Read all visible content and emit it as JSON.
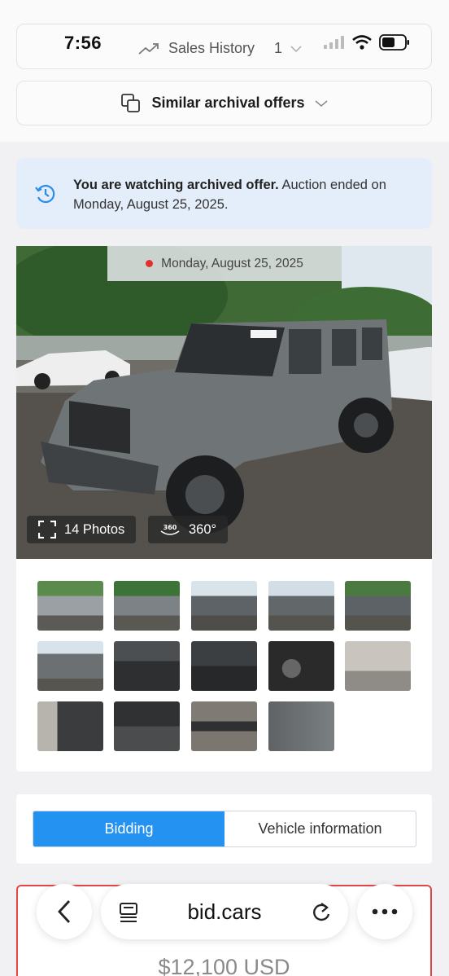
{
  "status_bar": {
    "time": "7:56",
    "sales_history_label": "Sales History",
    "sales_history_count": "1"
  },
  "similar": {
    "label": "Similar archival offers"
  },
  "notice": {
    "bold_text": "You are watching archived offer.",
    "text": " Auction ended on Monday, August 25, 2025."
  },
  "gallery": {
    "date": "Monday, August 25, 2025",
    "photos_label": "14 Photos",
    "view360_label": "360°",
    "thumbnail_count": 14
  },
  "tabs": [
    {
      "label": "Bidding",
      "active": true
    },
    {
      "label": "Vehicle information",
      "active": false
    }
  ],
  "price": {
    "value": "$12,100 USD"
  },
  "browser": {
    "url": "bid.cars"
  },
  "colors": {
    "accent": "#2492f0",
    "notice_bg": "#e4eefa",
    "alert_border": "#e04848"
  }
}
